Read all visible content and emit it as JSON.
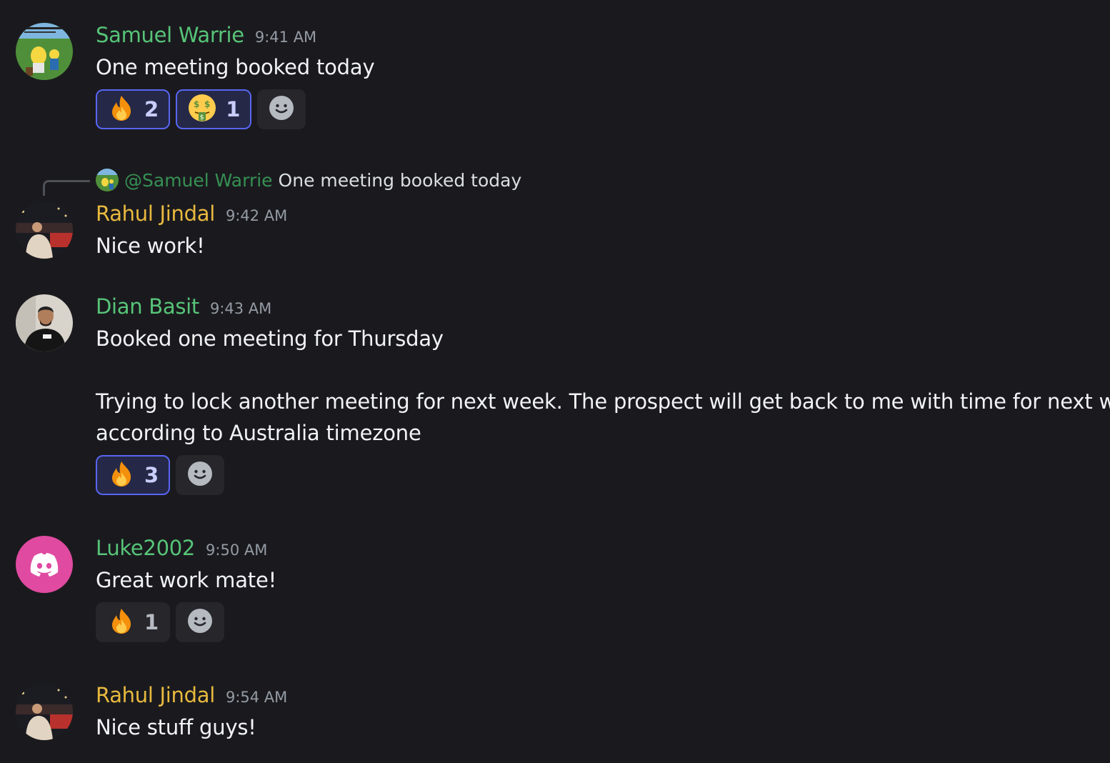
{
  "messages": [
    {
      "author": "Samuel Warrie",
      "author_color": "#57c478",
      "time": "9:41 AM",
      "text": "One meeting booked today",
      "reactions": [
        {
          "emoji": "fire",
          "count": "2",
          "active": true
        },
        {
          "emoji": "money-mouth",
          "count": "1",
          "active": true
        }
      ]
    },
    {
      "reply_to": {
        "mention": "@Samuel Warrie",
        "text": "One meeting booked today"
      },
      "author": "Rahul Jindal",
      "author_color": "#e8b93f",
      "time": "9:42 AM",
      "text": "Nice work!"
    },
    {
      "author": "Dian Basit",
      "author_color": "#57c478",
      "time": "9:43 AM",
      "lines": [
        "Booked one meeting for Thursday",
        "Trying to lock another meeting for next week. The prospect will get back to me with time for next week",
        "according to Australia timezone"
      ],
      "reactions": [
        {
          "emoji": "fire",
          "count": "3",
          "active": true
        }
      ]
    },
    {
      "author": "Luke2002",
      "author_color": "#57c478",
      "time": "9:50 AM",
      "text": "Great work mate!",
      "reactions": [
        {
          "emoji": "fire",
          "count": "1",
          "active": false
        }
      ]
    },
    {
      "author": "Rahul Jindal",
      "author_color": "#e8b93f",
      "time": "9:54 AM",
      "text": "Nice stuff guys!"
    }
  ],
  "icons": {
    "add_reaction": "smiley-face-icon",
    "discord_default_avatar": "discord-logo-icon",
    "discord_avatar_bg": "#e04aa0"
  }
}
